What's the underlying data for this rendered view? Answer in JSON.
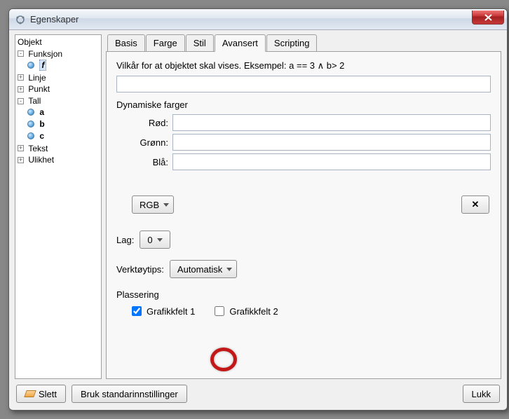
{
  "window": {
    "title": "Egenskaper"
  },
  "tree": {
    "root": "Objekt",
    "nodes": [
      {
        "label": "Funksjon",
        "expanded": true,
        "children": [
          {
            "label": "f",
            "selected": true,
            "boldItalic": true
          }
        ]
      },
      {
        "label": "Linje",
        "expanded": false
      },
      {
        "label": "Punkt",
        "expanded": false
      },
      {
        "label": "Tall",
        "expanded": true,
        "children": [
          {
            "label": "a",
            "bold": true
          },
          {
            "label": "b",
            "bold": true
          },
          {
            "label": "c",
            "bold": true
          }
        ]
      },
      {
        "label": "Tekst",
        "expanded": false
      },
      {
        "label": "Ulikhet",
        "expanded": false
      }
    ]
  },
  "tabs": {
    "items": [
      "Basis",
      "Farge",
      "Stil",
      "Avansert",
      "Scripting"
    ],
    "activeIndex": 3
  },
  "panel": {
    "condition_label": "Vilkår for at objektet skal vises. Eksempel: a == 3 ∧ b> 2",
    "condition_value": "",
    "dyn_colors_title": "Dynamiske farger",
    "red_label": "Rød:",
    "red_value": "",
    "green_label": "Grønn:",
    "green_value": "",
    "blue_label": "Blå:",
    "blue_value": "",
    "color_mode": "RGB",
    "clear_x": "✕",
    "layer_label": "Lag:",
    "layer_value": "0",
    "tooltip_label": "Verktøytips:",
    "tooltip_value": "Automatisk",
    "placement_title": "Plassering",
    "gfx1_label": "Grafikkfelt 1",
    "gfx1_checked": true,
    "gfx2_label": "Grafikkfelt 2",
    "gfx2_checked": false
  },
  "footer": {
    "delete": "Slett",
    "defaults": "Bruk standarinnstillinger",
    "close": "Lukk"
  }
}
